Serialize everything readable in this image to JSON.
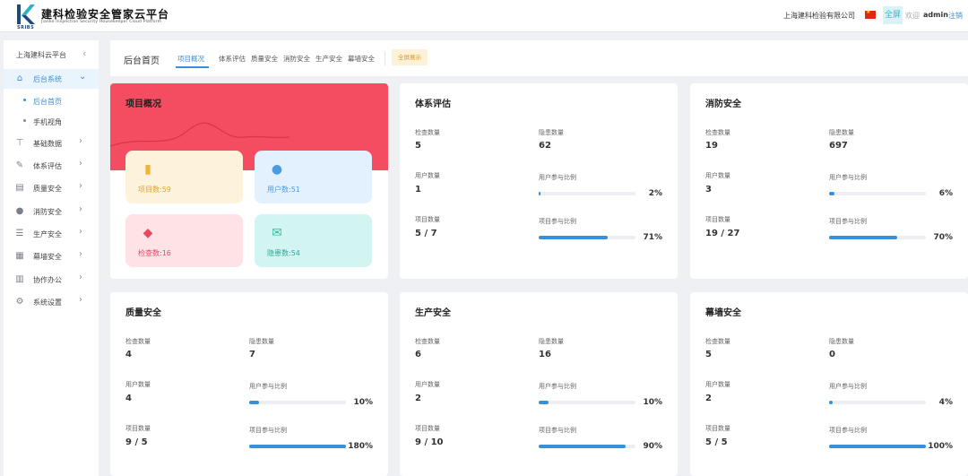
{
  "header": {
    "brand_title": "建科检验安全管家云平台",
    "brand_en": "Jianke Inspection Security Housekeeper Cloud Platform",
    "brand_abbr": "SRIBS",
    "company": "上海建科检验有限公司",
    "fullscreen": "全屏",
    "welcome": "欢迎",
    "user": "admin",
    "logout": "注销"
  },
  "sidebar": {
    "title": "上海建科云平台",
    "items": [
      {
        "label": "后台系统",
        "icon": "home-icon"
      },
      {
        "label": "后台首页"
      },
      {
        "label": "手机视角"
      },
      {
        "label": "基础数据",
        "icon": "sitemap-icon"
      },
      {
        "label": "体系评估",
        "icon": "tools-icon"
      },
      {
        "label": "质量安全",
        "icon": "card-icon"
      },
      {
        "label": "消防安全",
        "icon": "chat-icon"
      },
      {
        "label": "生产安全",
        "icon": "list-icon"
      },
      {
        "label": "幕墙安全",
        "icon": "wall-icon"
      },
      {
        "label": "协作办公",
        "icon": "table-icon"
      },
      {
        "label": "系统设置",
        "icon": "gear-icon"
      }
    ]
  },
  "tabbar": {
    "title": "后台首页",
    "tabs": [
      "项目概况",
      "体系评估",
      "质量安全",
      "消防安全",
      "生产安全",
      "幕墙安全"
    ],
    "show_all": "全屏展示"
  },
  "overview": {
    "title": "项目概况",
    "tiles": [
      {
        "label": "项目数:59",
        "icon": "bar-chart-icon"
      },
      {
        "label": "用户数:51",
        "icon": "users-icon"
      },
      {
        "label": "检查数:16",
        "icon": "layers-icon"
      },
      {
        "label": "隐患数:54",
        "icon": "mail-icon"
      }
    ]
  },
  "labels": {
    "check_count": "检查数量",
    "hazard_count": "隐患数量",
    "user_count": "用户数量",
    "user_ratio": "用户参与比例",
    "project_count": "项目数量",
    "project_ratio": "项目参与比例"
  },
  "cards": [
    {
      "title": "体系评估",
      "check": "5",
      "hazard": "62",
      "users": "1",
      "user_pct": "2%",
      "user_ratio": 0.02,
      "projects": "5 / 7",
      "proj_pct": "71%",
      "proj_ratio": 0.71
    },
    {
      "title": "消防安全",
      "check": "19",
      "hazard": "697",
      "users": "3",
      "user_pct": "6%",
      "user_ratio": 0.06,
      "projects": "19 / 27",
      "proj_pct": "70%",
      "proj_ratio": 0.7
    },
    {
      "title": "质量安全",
      "check": "4",
      "hazard": "7",
      "users": "4",
      "user_pct": "10%",
      "user_ratio": 0.1,
      "projects": "9 / 5",
      "proj_pct": "180%",
      "proj_ratio": 1.0
    },
    {
      "title": "生产安全",
      "check": "6",
      "hazard": "16",
      "users": "2",
      "user_pct": "10%",
      "user_ratio": 0.1,
      "projects": "9 / 10",
      "proj_pct": "90%",
      "proj_ratio": 0.9
    },
    {
      "title": "幕墙安全",
      "check": "5",
      "hazard": "0",
      "users": "2",
      "user_pct": "4%",
      "user_ratio": 0.04,
      "projects": "5 / 5",
      "proj_pct": "100%",
      "proj_ratio": 1.0
    }
  ],
  "colors": {
    "accent": "#3a8fd9",
    "banner": "#f44c60",
    "tile_yellow": "#fdf3dc",
    "tile_blue": "#e3f0fd",
    "tile_pink": "#fde2e6",
    "tile_teal": "#d2f5f1"
  }
}
